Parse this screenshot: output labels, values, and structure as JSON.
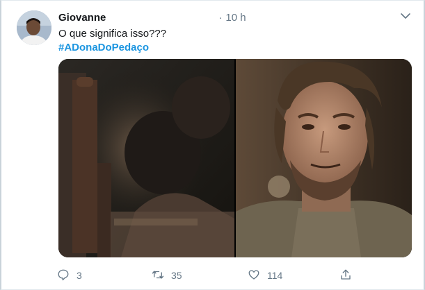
{
  "tweet": {
    "author_name": "Giovanne",
    "time_ago": "10 h",
    "separator": "·",
    "text": "O que significa isso???",
    "hashtag": "#ADonaDoPedaço"
  },
  "actions": {
    "reply_count": "3",
    "retweet_count": "35",
    "like_count": "114"
  },
  "icons": {
    "reply": "comment-icon",
    "retweet": "retweet-icon",
    "like": "heart-icon",
    "share": "share-icon",
    "menu": "chevron-down-icon"
  },
  "colors": {
    "text": "#14171a",
    "muted": "#657786",
    "hashtag": "#1b95e0"
  }
}
